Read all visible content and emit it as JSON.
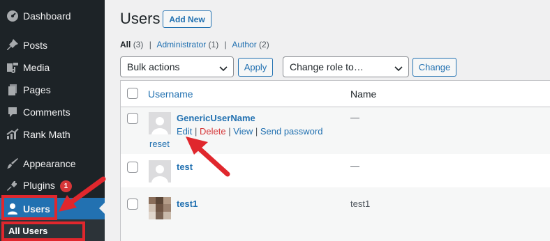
{
  "sidebar": {
    "items": [
      {
        "label": "Dashboard",
        "icon": "dashboard-icon"
      },
      {
        "label": "Posts",
        "icon": "pin-icon"
      },
      {
        "label": "Media",
        "icon": "media-icon"
      },
      {
        "label": "Pages",
        "icon": "pages-icon"
      },
      {
        "label": "Comments",
        "icon": "comments-icon"
      },
      {
        "label": "Rank Math",
        "icon": "rank-math-icon"
      },
      {
        "label": "Appearance",
        "icon": "appearance-icon"
      },
      {
        "label": "Plugins",
        "icon": "plugins-icon",
        "badge": "1"
      },
      {
        "label": "Users",
        "icon": "users-icon",
        "active": true
      }
    ],
    "submenu": {
      "label": "All Users"
    }
  },
  "header": {
    "title": "Users",
    "add_new_label": "Add New"
  },
  "filters": {
    "all_label": "All",
    "all_count": "(3)",
    "admin_label": "Administrator",
    "admin_count": "(1)",
    "author_label": "Author",
    "author_count": "(2)"
  },
  "actions": {
    "bulk_value": "Bulk actions",
    "apply_label": "Apply",
    "role_value": "Change role to…",
    "change_label": "Change"
  },
  "table": {
    "columns": {
      "username": "Username",
      "name": "Name"
    },
    "rows": [
      {
        "username": "GenericUserName",
        "name": "—",
        "actions": {
          "edit": "Edit",
          "delete": "Delete",
          "view": "View",
          "send_password": "Send password",
          "reset": "reset"
        }
      },
      {
        "username": "test",
        "name": "—"
      },
      {
        "username": "test1",
        "name": "test1"
      }
    ]
  },
  "colors": {
    "sidebar": "#1d2327",
    "accent": "#2271b1",
    "highlight": "#e0272d",
    "delete": "#d63638"
  }
}
